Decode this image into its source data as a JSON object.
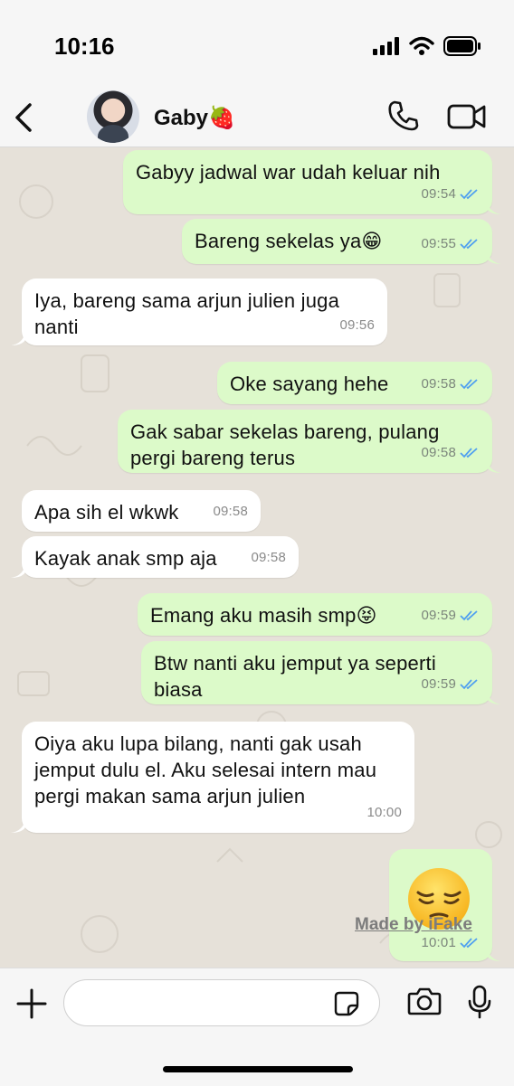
{
  "status": {
    "time": "10:16"
  },
  "header": {
    "contact_name": "Gaby🍓"
  },
  "messages": [
    {
      "dir": "out",
      "text": "Gabyy jadwal war udah keluar nih",
      "time": "09:54",
      "read": true
    },
    {
      "dir": "out",
      "text": "Bareng sekelas ya😁",
      "time": "09:55",
      "read": true
    },
    {
      "dir": "in",
      "text": "Iya, bareng sama arjun julien juga nanti",
      "time": "09:56"
    },
    {
      "dir": "out",
      "text": "Oke sayang hehe",
      "time": "09:58",
      "read": true
    },
    {
      "dir": "out",
      "text": "Gak sabar sekelas bareng, pulang pergi bareng terus",
      "time": "09:58",
      "read": true
    },
    {
      "dir": "in",
      "text": "Apa sih el wkwk",
      "time": "09:58"
    },
    {
      "dir": "in",
      "text": "Kayak anak smp aja",
      "time": "09:58"
    },
    {
      "dir": "out",
      "text": "Emang aku masih smp😝",
      "time": "09:59",
      "read": true
    },
    {
      "dir": "out",
      "text": "Btw nanti aku jemput ya seperti biasa",
      "time": "09:59",
      "read": true
    },
    {
      "dir": "in",
      "text": "Oiya aku lupa bilang, nanti gak usah jemput dulu el. Aku selesai intern mau pergi makan sama arjun julien",
      "time": "10:00"
    },
    {
      "dir": "out",
      "emoji": "pensive-face",
      "time": "10:01",
      "read": true
    }
  ],
  "watermark": "Made by iFake",
  "colors": {
    "outgoing": "#dcfac9",
    "incoming": "#ffffff",
    "read_ticks": "#4f9ff0"
  },
  "icons": [
    "back-chevron-icon",
    "phone-icon",
    "video-camera-icon",
    "plus-icon",
    "sticker-icon",
    "camera-icon",
    "microphone-icon",
    "signal-icon",
    "wifi-icon",
    "battery-icon"
  ]
}
